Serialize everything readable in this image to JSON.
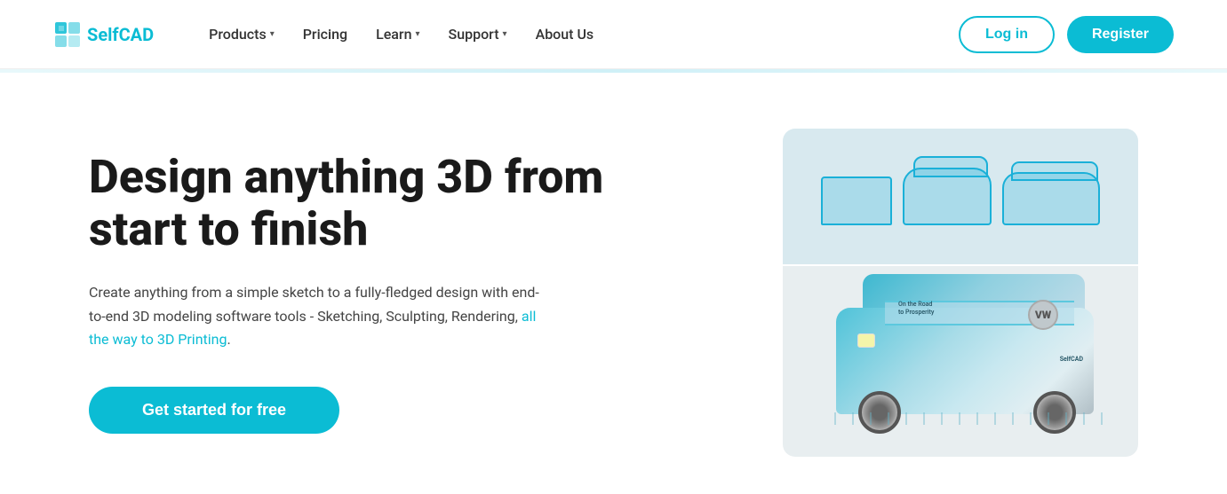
{
  "brand": {
    "name_prefix": "Self",
    "name_suffix": "CAD",
    "logo_alt": "SelfCAD logo"
  },
  "navbar": {
    "links": [
      {
        "id": "products",
        "label": "Products",
        "has_dropdown": true
      },
      {
        "id": "pricing",
        "label": "Pricing",
        "has_dropdown": false
      },
      {
        "id": "learn",
        "label": "Learn",
        "has_dropdown": true
      },
      {
        "id": "support",
        "label": "Support",
        "has_dropdown": true
      },
      {
        "id": "about",
        "label": "About Us",
        "has_dropdown": false
      }
    ],
    "login_label": "Log in",
    "register_label": "Register"
  },
  "hero": {
    "title": "Design anything 3D from start to finish",
    "subtitle_plain": "Create anything from a simple sketch to a fully-fledged design with end-to-end 3D modeling software tools - Sketching, Sculpting, Rendering,",
    "subtitle_highlight": " all the way to 3D Printing",
    "subtitle_end": ".",
    "cta_label": "Get started for free"
  },
  "image_area": {
    "top_label": "Wireframe 3D models",
    "bottom_label": "VW Bus 3D render",
    "bus_text_line1": "On the Road",
    "bus_text_line2": "to Prosperity",
    "selfcad_label": "SelfCAD"
  },
  "colors": {
    "primary": "#0bbcd4",
    "text_dark": "#1a1a1a",
    "text_body": "#444"
  }
}
